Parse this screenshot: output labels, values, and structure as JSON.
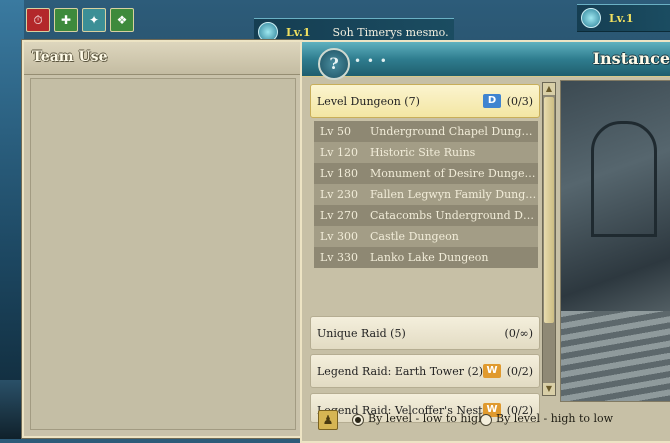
{
  "buffs": [
    {
      "icon": "clock-buff-icon",
      "color": "red",
      "glyph": "⏱"
    },
    {
      "icon": "potion-buff-icon",
      "color": "green",
      "glyph": "✚"
    },
    {
      "icon": "shield-buff-icon",
      "color": "teal",
      "glyph": "✦"
    },
    {
      "icon": "leaf-buff-icon",
      "color": "green",
      "glyph": "❖"
    }
  ],
  "nameplate_1": {
    "level": "Lv.1",
    "name": "Soh Timerys mesmo."
  },
  "nameplate_2": {
    "level": "Lv.1"
  },
  "team_panel": {
    "title": "Team Use"
  },
  "instance_panel": {
    "title": "Instance",
    "help": "?",
    "categories": [
      {
        "name": "Level Dungeon (7)",
        "badge": "D",
        "count": "(0/3)"
      },
      {
        "name": "Unique Raid (5)",
        "count": "(0/∞)"
      },
      {
        "name": "Legend Raid: Earth Tower (2)",
        "badge": "W",
        "count": "(0/2)"
      },
      {
        "name": "Legend Raid: Velcoffer's Nest...",
        "badge": "W",
        "count": "(0/2)"
      }
    ],
    "dungeons": [
      {
        "level": "Lv 50",
        "name": "Underground Chapel Dungeon"
      },
      {
        "level": "Lv 120",
        "name": "Historic Site Ruins"
      },
      {
        "level": "Lv 180",
        "name": "Monument of Desire Dungeon"
      },
      {
        "level": "Lv 230",
        "name": "Fallen Legwyn Family Dungeon"
      },
      {
        "level": "Lv 270",
        "name": "Catacombs Underground Du..."
      },
      {
        "level": "Lv 300",
        "name": "Castle Dungeon"
      },
      {
        "level": "Lv 330",
        "name": "Lanko Lake Dungeon"
      }
    ],
    "sort": {
      "option_1": "By level - low to high",
      "option_2": "By level - high to low",
      "selected": "option_1"
    }
  },
  "colors": {
    "header_teal": "#2f7d8f",
    "panel_beige": "#c7c0a6",
    "badge_d": "#3f84d0",
    "badge_w": "#e09a2e"
  }
}
